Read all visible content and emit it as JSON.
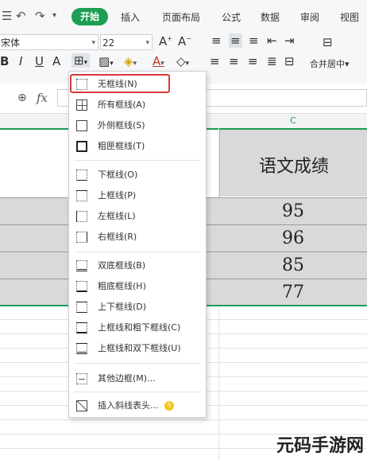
{
  "ribbon": {
    "tabs": [
      {
        "label": "开始",
        "active": true
      },
      {
        "label": "插入"
      },
      {
        "label": "页面布局"
      },
      {
        "label": "公式"
      },
      {
        "label": "数据"
      },
      {
        "label": "审阅"
      },
      {
        "label": "视图"
      }
    ],
    "font_name": "宋体",
    "font_size": "22",
    "merge_label": "合并居中",
    "merge_arrow": "▾"
  },
  "formula_bar": {
    "fx": "fx"
  },
  "sheet": {
    "column_c": "C",
    "header_text": "语文成绩",
    "scores": [
      "95",
      "96",
      "85",
      "77"
    ]
  },
  "border_menu": {
    "items": [
      {
        "label": "无框线(N)",
        "icon": "no-border-icon"
      },
      {
        "label": "所有框线(A)",
        "icon": "all-borders-icon"
      },
      {
        "label": "外侧框线(S)",
        "icon": "outside-borders-icon"
      },
      {
        "label": "粗匣框线(T)",
        "icon": "thick-box-border-icon"
      },
      {
        "label": "下框线(O)",
        "icon": "bottom-border-icon"
      },
      {
        "label": "上框线(P)",
        "icon": "top-border-icon"
      },
      {
        "label": "左框线(L)",
        "icon": "left-border-icon"
      },
      {
        "label": "右框线(R)",
        "icon": "right-border-icon"
      },
      {
        "label": "双底框线(B)",
        "icon": "double-bottom-border-icon"
      },
      {
        "label": "粗底框线(H)",
        "icon": "thick-bottom-border-icon"
      },
      {
        "label": "上下框线(D)",
        "icon": "top-bottom-border-icon"
      },
      {
        "label": "上框线和粗下框线(C)",
        "icon": "top-thick-bottom-border-icon"
      },
      {
        "label": "上框线和双下框线(U)",
        "icon": "top-double-bottom-border-icon"
      },
      {
        "label": "其他边框(M)...",
        "icon": "more-borders-icon"
      },
      {
        "label": "插入斜线表头...",
        "icon": "diagonal-header-icon"
      }
    ]
  },
  "watermark": "元码手游网",
  "colors": {
    "accent": "#1d9e54",
    "highlight": "#d93a3a",
    "filled_cell": "#d9d9d9"
  }
}
